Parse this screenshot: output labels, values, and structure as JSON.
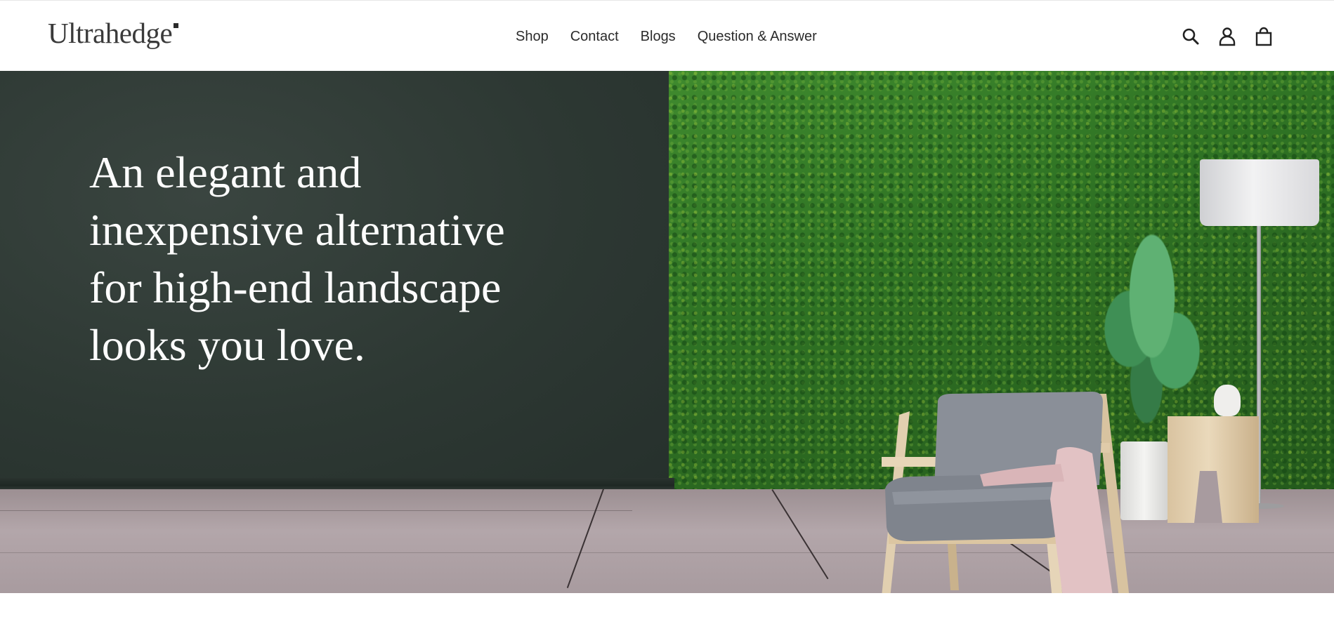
{
  "header": {
    "logo_text": "Ultrahedge",
    "nav": [
      {
        "label": "Shop"
      },
      {
        "label": "Contact"
      },
      {
        "label": "Blogs"
      },
      {
        "label": "Question & Answer"
      }
    ],
    "icons": [
      "search-icon",
      "account-icon",
      "cart-icon"
    ]
  },
  "hero": {
    "headline_lines": [
      "An elegant and",
      "inexpensive alternative",
      "for high-end landscape",
      "looks you love."
    ]
  },
  "colors": {
    "left_wall": "#2d3833",
    "hedge_green": "#2f7324",
    "floor": "#a89b9f",
    "headline_text": "#ffffff"
  }
}
